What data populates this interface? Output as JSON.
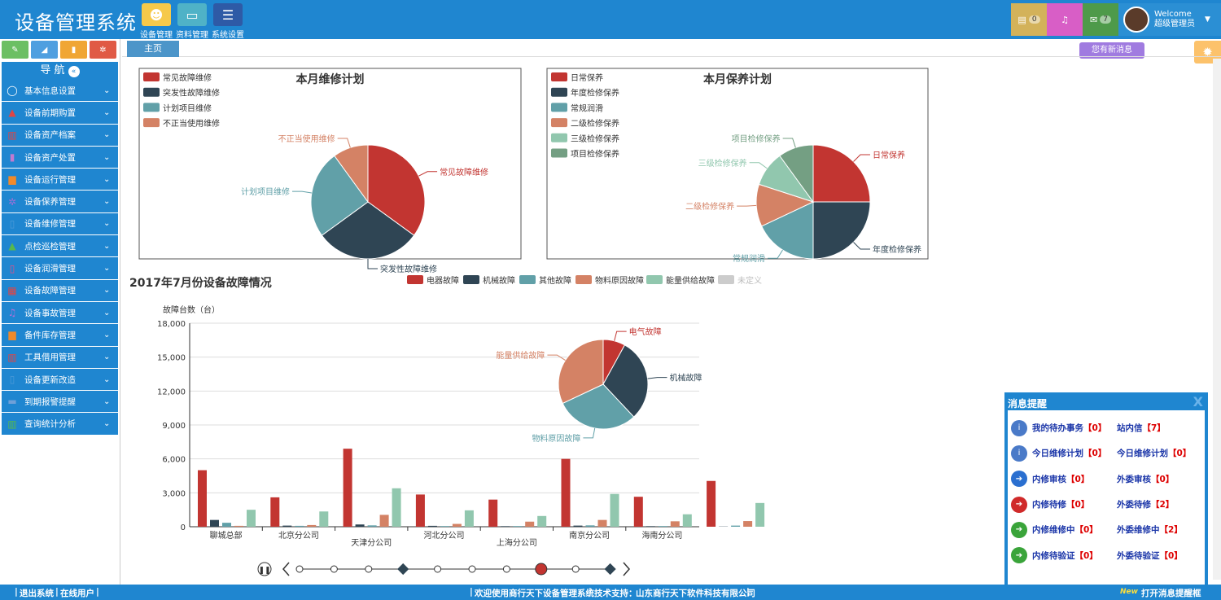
{
  "header": {
    "title": "设备管理系统",
    "nav": [
      {
        "label": "设备管理",
        "icon": "user-icon",
        "color": "#f6c94a"
      },
      {
        "label": "资料管理",
        "icon": "folder-icon",
        "color": "#4fb2c7"
      },
      {
        "label": "系统设置",
        "icon": "list-icon",
        "color": "#2e5aa6"
      }
    ],
    "tools": [
      {
        "icon": "message-list-icon",
        "count": "0",
        "color": "#d3b25a"
      },
      {
        "icon": "bell-icon",
        "count": "",
        "color": "#d85ec6"
      },
      {
        "icon": "envelope-icon",
        "count": "7",
        "color": "#4e9a4a"
      }
    ],
    "welcome": "Welcome",
    "username": "超级管理员",
    "new_msg_tip": "您有新消息"
  },
  "sidebar": {
    "nav_title": "导 航",
    "quick_buttons": [
      {
        "icon": "pencil-icon",
        "color": "#6cbf64"
      },
      {
        "icon": "signal-icon",
        "color": "#4f9fe0"
      },
      {
        "icon": "book-icon",
        "color": "#f0a634"
      },
      {
        "icon": "cogs-icon",
        "color": "#e05a45"
      }
    ],
    "items": [
      {
        "label": "基本信息设置",
        "icon": "comment-icon",
        "icon_color": "#fff"
      },
      {
        "label": "设备前期购置",
        "icon": "flask-icon",
        "icon_color": "#e04545"
      },
      {
        "label": "设备资产档案",
        "icon": "bar-chart-icon",
        "icon_color": "#e04545"
      },
      {
        "label": "设备资产处置",
        "icon": "book-icon",
        "icon_color": "#c07ad0"
      },
      {
        "label": "设备运行管理",
        "icon": "copy-icon",
        "icon_color": "#f08a2a"
      },
      {
        "label": "设备保养管理",
        "icon": "cogs-icon",
        "icon_color": "#a070d8"
      },
      {
        "label": "设备维修管理",
        "icon": "bookmark-icon",
        "icon_color": "#4c9bd8"
      },
      {
        "label": "点检巡检管理",
        "icon": "flask-icon",
        "icon_color": "#56b84e"
      },
      {
        "label": "设备润滑管理",
        "icon": "bookmark-icon",
        "icon_color": "#e0508a"
      },
      {
        "label": "设备故障管理",
        "icon": "calendar-icon",
        "icon_color": "#e04545"
      },
      {
        "label": "设备事故管理",
        "icon": "bell-icon",
        "icon_color": "#b070d8"
      },
      {
        "label": "备件库存管理",
        "icon": "copy-icon",
        "icon_color": "#f08a2a"
      },
      {
        "label": "工具借用管理",
        "icon": "bar-chart-icon",
        "icon_color": "#e04545"
      },
      {
        "label": "设备更新改造",
        "icon": "bookmark-icon",
        "icon_color": "#4c9bd8"
      },
      {
        "label": "到期报警提醒",
        "icon": "briefcase-icon",
        "icon_color": "#6fa0d8"
      },
      {
        "label": "查询统计分析",
        "icon": "bar-chart-icon",
        "icon_color": "#56b84e"
      }
    ]
  },
  "main": {
    "tab": "主页"
  },
  "chart_data": [
    {
      "type": "pie",
      "title": "本月维修计划",
      "categories": [
        "常见故障维修",
        "突发性故障维修",
        "计划项目维修",
        "不正当使用维修"
      ],
      "values": [
        35,
        30,
        25,
        10
      ],
      "colors": [
        "#c23531",
        "#2f4554",
        "#61a0a8",
        "#d48265"
      ],
      "legend": "top-left"
    },
    {
      "type": "pie",
      "title": "本月保养计划",
      "categories": [
        "日常保养",
        "年度检修保养",
        "常规润滑",
        "二级检修保养",
        "三级检修保养",
        "项目检修保养"
      ],
      "values": [
        25,
        25,
        18,
        12,
        10,
        10
      ],
      "colors": [
        "#c23531",
        "#2f4554",
        "#61a0a8",
        "#d48265",
        "#91c7ae",
        "#749f83"
      ],
      "legend": "top-left"
    },
    {
      "type": "bar",
      "title": "2017年7月份设备故障情况",
      "ylabel": "故障台数（台）",
      "ylim": [
        0,
        18000
      ],
      "yticks": [
        "0",
        "3,000",
        "6,000",
        "9,000",
        "12,000",
        "15,000",
        "18,000"
      ],
      "categories": [
        "聊城总部",
        "北京分公司",
        "天津分公司",
        "河北分公司",
        "上海分公司",
        "南京分公司",
        "海南分公司",
        ""
      ],
      "series": [
        {
          "name": "电器故障",
          "color": "#c23531",
          "values": [
            5000,
            2600,
            6900,
            2850,
            2400,
            6000,
            2650,
            4050
          ]
        },
        {
          "name": "机械故障",
          "color": "#2f4554",
          "values": [
            600,
            100,
            200,
            80,
            50,
            100,
            50,
            20
          ]
        },
        {
          "name": "其他故障",
          "color": "#61a0a8",
          "values": [
            350,
            80,
            120,
            60,
            60,
            120,
            60,
            100
          ]
        },
        {
          "name": "物料原因故障",
          "color": "#d48265",
          "values": [
            80,
            150,
            1050,
            250,
            450,
            600,
            480,
            500
          ]
        },
        {
          "name": "能量供给故障",
          "color": "#91c7ae",
          "values": [
            1500,
            1350,
            3400,
            1450,
            950,
            2900,
            1100,
            2100
          ]
        },
        {
          "name": "未定义",
          "color": "#cccccc",
          "values": [
            0,
            0,
            0,
            0,
            0,
            0,
            0,
            0
          ]
        }
      ],
      "legend": "top"
    },
    {
      "type": "pie",
      "title": "",
      "categories": [
        "电气故障",
        "机械故障",
        "物料原因故障",
        "能量供给故障"
      ],
      "values": [
        8,
        30,
        30,
        32
      ],
      "colors": [
        "#c23531",
        "#2f4554",
        "#61a0a8",
        "#d48265"
      ]
    }
  ],
  "timeline": {
    "nodes": 10,
    "current": 7
  },
  "msgbox": {
    "title": "消息提醒",
    "rows": [
      {
        "icon": "info-icon",
        "color": "#4a7ac8",
        "a": "我的待办事务",
        "a_n": "【0】",
        "b": "站内信",
        "b_n": "【7】"
      },
      {
        "icon": "info-icon",
        "color": "#4a7ac8",
        "a": "今日维修计划",
        "a_n": "【0】",
        "b": "今日维修计划",
        "b_n": "【0】"
      },
      {
        "icon": "arrow-right-icon",
        "color": "#2a6fd0",
        "a": "内修审核",
        "a_n": "【0】",
        "b": "外委审核",
        "b_n": "【0】"
      },
      {
        "icon": "arrow-right-icon",
        "color": "#d02a2a",
        "a": "内修待修",
        "a_n": "【0】",
        "b": "外委待修",
        "b_n": "【2】"
      },
      {
        "icon": "arrow-right-icon",
        "color": "#3aa43a",
        "a": "内修维修中",
        "a_n": "【0】",
        "b": "外委维修中",
        "b_n": "【2】"
      },
      {
        "icon": "arrow-right-icon",
        "color": "#3aa43a",
        "a": "内修待验证",
        "a_n": "【0】",
        "b": "外委待验证",
        "b_n": "【0】"
      }
    ]
  },
  "footer": {
    "logout": "退出系统",
    "online": "在线用户",
    "welcome": "欢迎使用商行天下设备管理系统",
    "support": "技术支持：",
    "company": "山东商行天下软件科技有限公司",
    "open_reminder": "打开消息提醒框",
    "new_badge": "New"
  }
}
